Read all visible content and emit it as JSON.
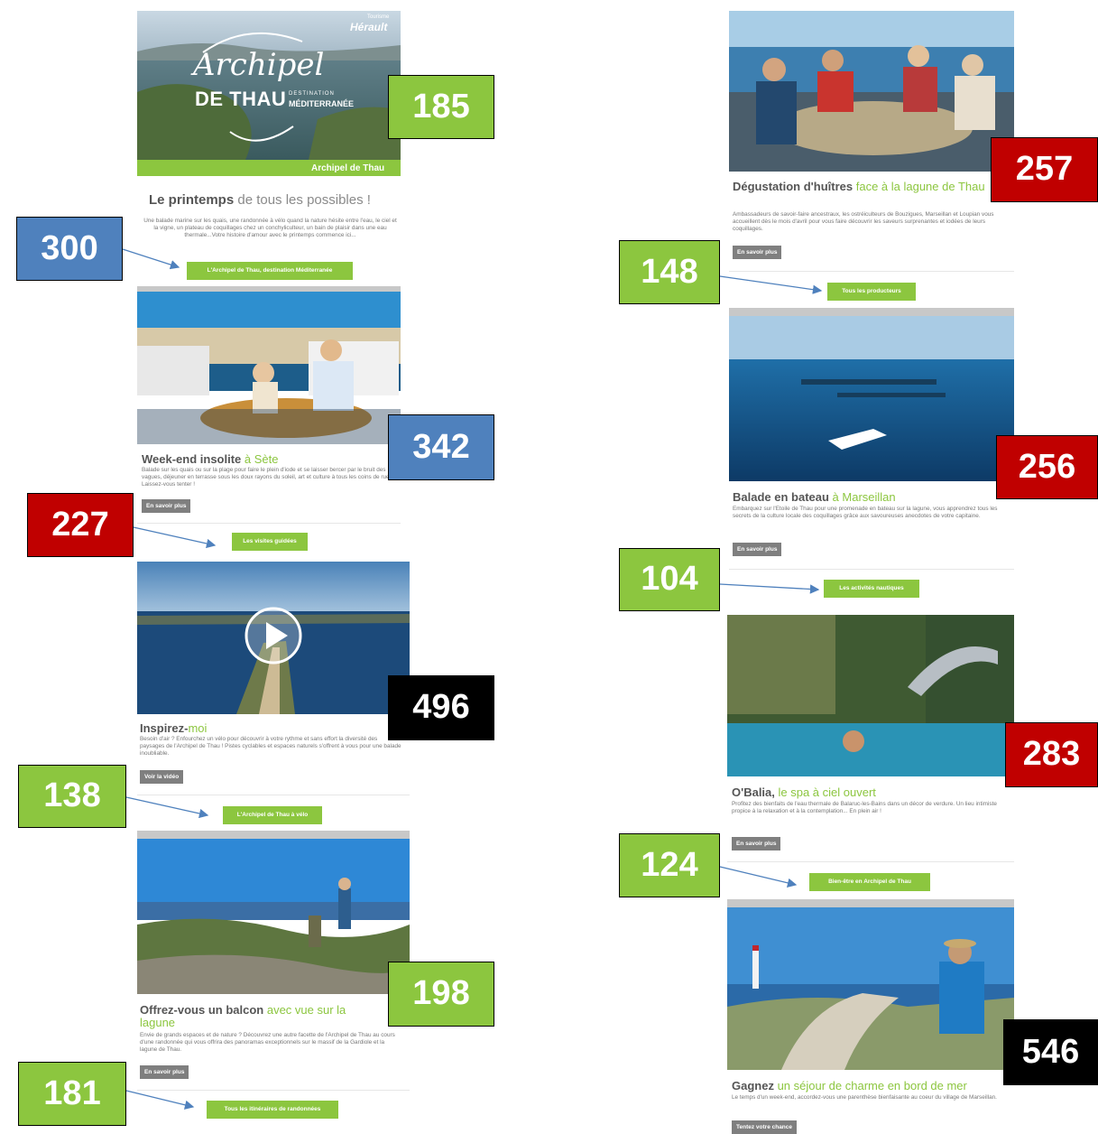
{
  "hero": {
    "brand_small": "Tourisme",
    "brand_big": "Hérault",
    "logo_line1": "Archipel",
    "logo_line2": "DE THAU",
    "logo_dest1": "DESTINATION",
    "logo_dest2": "MÉDITERRANÉE",
    "band_label": "Archipel de Thau"
  },
  "intro": {
    "title_bold": "Le printemps",
    "title_rest": " de tous les possibles !",
    "text": "Une balade marine sur les quais, une randonnée à vélo quand la nature hésite entre l'eau, le ciel et la vigne, un plateau de coquillages chez un conchyliculteur, un bain de plaisir dans une eau thermale...Votre histoire d'amour avec le printemps commence ici...",
    "cta": "L'Archipel de Thau, destination Méditerranée"
  },
  "left_blocks": [
    {
      "title_bold": "Week-end insolite",
      "title_rest": " à Sète",
      "text": "Balade sur les quais ou sur la plage pour faire le plein d'iode et se laisser bercer par le bruit des vagues, déjeuner en terrasse sous les doux rayons du soleil, art et culture à tous les coins de rue... Laissez-vous tenter !",
      "button": "En savoir plus",
      "cta": "Les visites guidées"
    },
    {
      "title_bold": "Inspirez-",
      "title_rest": "moi",
      "text": "Besoin d'air ? Enfourchez un vélo pour découvrir à votre rythme et sans effort la diversité des paysages de l'Archipel de Thau ! Pistes cyclables et espaces naturels s'offrent à vous pour une balade inoubliable.",
      "button": "Voir la vidéo",
      "cta": "L'Archipel de Thau à vélo"
    },
    {
      "title_bold": "Offrez-vous un balcon",
      "title_rest": " avec vue sur la lagune",
      "text": "Envie de grands espaces et de nature ? Découvrez une autre facette de l'Archipel de Thau au cours d'une randonnée qui vous offrira des panoramas exceptionnels sur le massif de la Gardiole et la lagune de Thau.",
      "button": "En savoir plus",
      "cta": "Tous les itinéraires de randonnées"
    }
  ],
  "right_blocks": [
    {
      "title_bold": "Dégustation d'huîtres",
      "title_rest": " face à la lagune de Thau",
      "text": "Ambassadeurs de savoir-faire ancestraux, les ostréiculteurs de Bouzigues, Marseillan et Loupian vous accueillent dès le mois d'avril pour vous faire découvrir les saveurs surprenantes et iodées de leurs coquillages.",
      "button": "En savoir plus",
      "cta": "Tous les producteurs"
    },
    {
      "title_bold": "Balade en bateau",
      "title_rest": " à Marseillan",
      "text": "Embarquez sur l'Etoile de Thau pour une promenade en bateau sur la lagune, vous apprendrez tous les secrets de la culture locale des coquillages grâce aux savoureuses anecdotes de votre capitaine.",
      "button": "En savoir plus",
      "cta": "Les activités nautiques"
    },
    {
      "title_bold": "O'Balia,",
      "title_rest": " le spa à ciel ouvert",
      "text": "Profitez des bienfaits de l'eau thermale de Balaruc-les-Bains dans un décor de verdure. Un lieu intimiste propice à la relaxation et à la contemplation... En plein air !",
      "button": "En savoir plus",
      "cta": "Bien-être en Archipel de Thau"
    },
    {
      "title_bold": "Gagnez",
      "title_rest": " un séjour de charme en bord de mer",
      "text": "Le temps d'un week-end, accordez-vous une parenthèse bienfaisante au coeur du village de Marseillan.",
      "button": "Tentez votre chance"
    }
  ],
  "badges": [
    {
      "value": "185",
      "color": "#8cc63f"
    },
    {
      "value": "300",
      "color": "#4f81bd"
    },
    {
      "value": "342",
      "color": "#4f81bd"
    },
    {
      "value": "227",
      "color": "#c00000"
    },
    {
      "value": "496",
      "color": "#000000"
    },
    {
      "value": "138",
      "color": "#8cc63f"
    },
    {
      "value": "198",
      "color": "#8cc63f"
    },
    {
      "value": "181",
      "color": "#8cc63f"
    },
    {
      "value": "257",
      "color": "#c00000"
    },
    {
      "value": "148",
      "color": "#8cc63f"
    },
    {
      "value": "256",
      "color": "#c00000"
    },
    {
      "value": "104",
      "color": "#8cc63f"
    },
    {
      "value": "283",
      "color": "#c00000"
    },
    {
      "value": "124",
      "color": "#8cc63f"
    },
    {
      "value": "546",
      "color": "#000000"
    }
  ],
  "colors": {
    "accent_green": "#8cc63f",
    "button_grey": "#7f7f7f",
    "arrow_blue": "#4f81bd"
  },
  "icons": {
    "play": "play-icon"
  }
}
